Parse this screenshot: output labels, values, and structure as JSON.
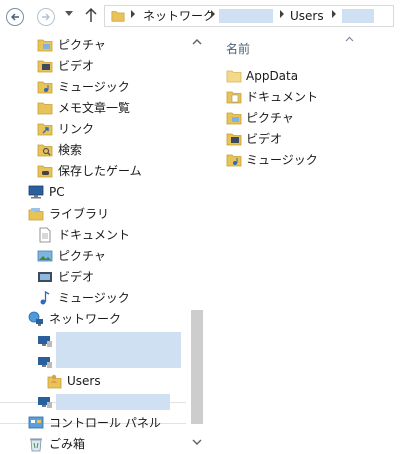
{
  "address_bar": {
    "crumbs": [
      "ネットワーク",
      "Users"
    ]
  },
  "nav_pane": {
    "items": [
      {
        "label": "ピクチャ",
        "icon": "pictures-folder-icon"
      },
      {
        "label": "ビデオ",
        "icon": "videos-folder-icon"
      },
      {
        "label": "ミュージック",
        "icon": "music-folder-icon"
      },
      {
        "label": "メモ文章一覧",
        "icon": "folder-icon"
      },
      {
        "label": "リンク",
        "icon": "links-folder-icon"
      },
      {
        "label": "検索",
        "icon": "search-folder-icon"
      },
      {
        "label": "保存したゲーム",
        "icon": "saved-games-folder-icon"
      },
      {
        "label": "PC",
        "icon": "computer-icon"
      },
      {
        "label": "ライブラリ",
        "icon": "libraries-icon"
      },
      {
        "label": "ドキュメント",
        "icon": "documents-library-icon"
      },
      {
        "label": "ピクチャ",
        "icon": "pictures-library-icon"
      },
      {
        "label": "ビデオ",
        "icon": "videos-library-icon"
      },
      {
        "label": "ミュージック",
        "icon": "music-library-icon"
      },
      {
        "label": "ネットワーク",
        "icon": "network-icon"
      },
      {
        "label": "Users",
        "icon": "user-folder-icon",
        "selected": true
      },
      {
        "label": "コントロール パネル",
        "icon": "control-panel-icon"
      },
      {
        "label": "ごみ箱",
        "icon": "recycle-bin-icon"
      }
    ]
  },
  "content_pane": {
    "column_header": "名前",
    "files": [
      {
        "label": "AppData",
        "icon": "folder-icon"
      },
      {
        "label": "ドキュメント",
        "icon": "documents-folder-icon"
      },
      {
        "label": "ピクチャ",
        "icon": "pictures-folder-icon"
      },
      {
        "label": "ビデオ",
        "icon": "videos-folder-icon"
      },
      {
        "label": "ミュージック",
        "icon": "music-folder-icon"
      }
    ]
  },
  "colors": {
    "folder": "#e8c35a",
    "redaction": "#cfe0f2",
    "header_text": "#4c607a"
  }
}
